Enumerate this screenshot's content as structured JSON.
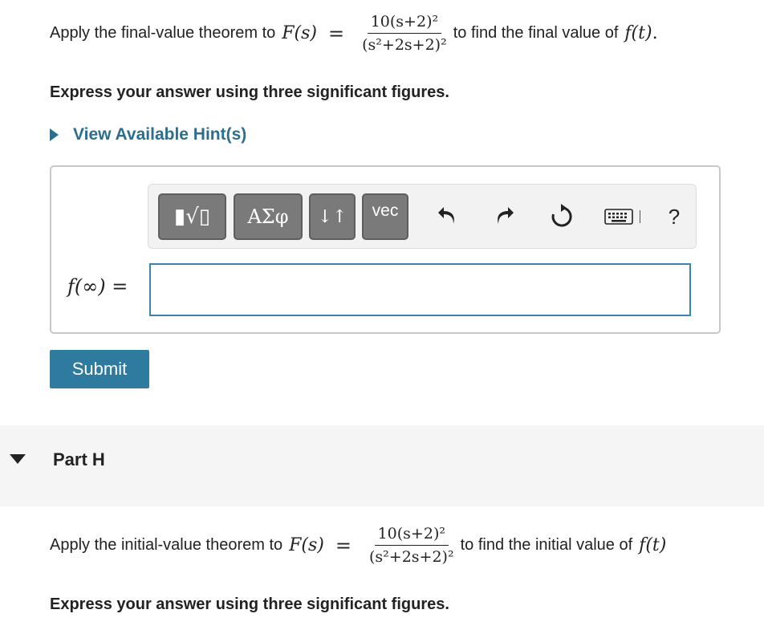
{
  "part_g": {
    "q_prefix": "Apply the final-value theorem to",
    "q_func": "F(s)",
    "equals": "=",
    "q_num": "10(s+2)²",
    "q_den": "(s²+2s+2)²",
    "q_suffix_text": "to find the final value of",
    "q_suffix_func": "f(t)",
    "q_period": ".",
    "instruction": "Express your answer using three significant figures.",
    "hint_link": "View Available Hint(s)",
    "toolbar": {
      "templates_label": "▮√▯",
      "greek_label": "ΑΣφ",
      "arrows_label": "↓↑",
      "vec_label": "vec",
      "help_label": "?"
    },
    "answer_label": "f(∞) =",
    "answer_value": "",
    "submit_label": "Submit"
  },
  "part_h": {
    "title": "Part H",
    "q_prefix": "Apply the initial-value theorem to",
    "q_func": "F(s)",
    "equals": "=",
    "q_num": "10(s+2)²",
    "q_den": "(s²+2s+2)²",
    "q_suffix_text": "to find the initial value of",
    "q_suffix_func": "f(t)",
    "instruction": "Express your answer using three significant figures."
  }
}
